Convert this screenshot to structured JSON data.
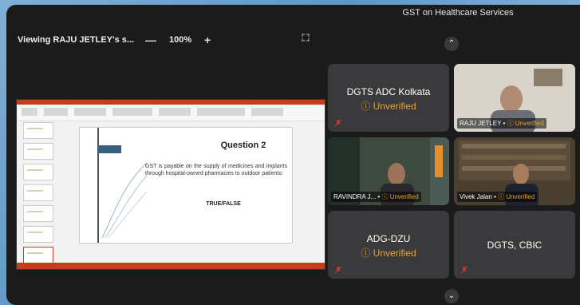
{
  "share": {
    "title": "Viewing RAJU JETLEY's s...",
    "zoom_out": "—",
    "zoom": "100%",
    "zoom_in": "+"
  },
  "slide": {
    "question": "Question 2",
    "body": "GST is payable on the supply of medicines and implants through hospital-owned pharmacies to outdoor patients:",
    "answer": "TRUE/FALSE"
  },
  "meeting": {
    "title": "GST on Healthcare Services",
    "nav_up": "⌃",
    "nav_down": "⌄"
  },
  "participants": [
    {
      "name": "DGTS ADC Kolkata",
      "status": "Unverified"
    },
    {
      "name": "RAJU JETLEY",
      "status": "Unverified"
    },
    {
      "name": "RAVINDRA J...",
      "status": "Unverified"
    },
    {
      "name": "Vivek Jalan",
      "status": "Unverified"
    },
    {
      "name": "ADG-DZU",
      "status": "Unverified"
    },
    {
      "name": "DGTS, CBIC",
      "status": ""
    }
  ],
  "colors": {
    "unverified": "#e5a22b",
    "mic_off": "#c0392b",
    "ppt": "#c43e1c"
  },
  "icons": [
    "expand-icon",
    "chevron-up-icon",
    "chevron-down-icon",
    "mic-off-icon",
    "warning-icon",
    "screen-share-icon"
  ]
}
